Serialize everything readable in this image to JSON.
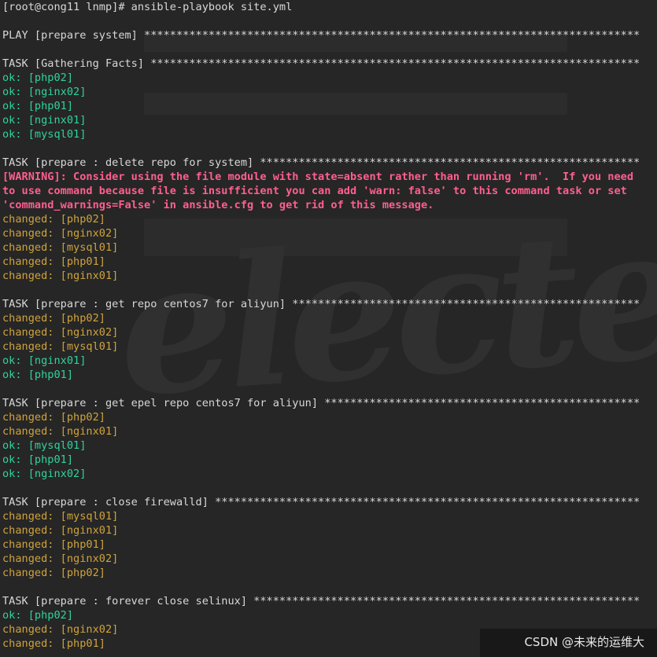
{
  "terminal": {
    "lines": [
      {
        "kind": "def",
        "text": "[root@cong11 lnmp]# ansible-playbook site.yml"
      },
      {
        "kind": "blank",
        "text": ""
      },
      {
        "kind": "def",
        "text": "PLAY [prepare system] *****************************************************************************"
      },
      {
        "kind": "blank",
        "text": ""
      },
      {
        "kind": "def",
        "text": "TASK [Gathering Facts] ****************************************************************************"
      },
      {
        "kind": "ok",
        "text": "ok: [php02]"
      },
      {
        "kind": "ok",
        "text": "ok: [nginx02]"
      },
      {
        "kind": "ok",
        "text": "ok: [php01]"
      },
      {
        "kind": "ok",
        "text": "ok: [nginx01]"
      },
      {
        "kind": "ok",
        "text": "ok: [mysql01]"
      },
      {
        "kind": "blank",
        "text": ""
      },
      {
        "kind": "def",
        "text": "TASK [prepare : delete repo for system] ***********************************************************"
      },
      {
        "kind": "warn",
        "text": "[WARNING]: Consider using the file module with state=absent rather than running 'rm'.  If you need"
      },
      {
        "kind": "warn",
        "text": "to use command because file is insufficient you can add 'warn: false' to this command task or set"
      },
      {
        "kind": "warn",
        "text": "'command_warnings=False' in ansible.cfg to get rid of this message."
      },
      {
        "kind": "changed",
        "text": "changed: [php02]"
      },
      {
        "kind": "changed",
        "text": "changed: [nginx02]"
      },
      {
        "kind": "changed",
        "text": "changed: [mysql01]"
      },
      {
        "kind": "changed",
        "text": "changed: [php01]"
      },
      {
        "kind": "changed",
        "text": "changed: [nginx01]"
      },
      {
        "kind": "blank",
        "text": ""
      },
      {
        "kind": "def",
        "text": "TASK [prepare : get repo centos7 for aliyun] ******************************************************"
      },
      {
        "kind": "changed",
        "text": "changed: [php02]"
      },
      {
        "kind": "changed",
        "text": "changed: [nginx02]"
      },
      {
        "kind": "changed",
        "text": "changed: [mysql01]"
      },
      {
        "kind": "ok",
        "text": "ok: [nginx01]"
      },
      {
        "kind": "ok",
        "text": "ok: [php01]"
      },
      {
        "kind": "blank",
        "text": ""
      },
      {
        "kind": "def",
        "text": "TASK [prepare : get epel repo centos7 for aliyun] *************************************************"
      },
      {
        "kind": "changed",
        "text": "changed: [php02]"
      },
      {
        "kind": "changed",
        "text": "changed: [nginx01]"
      },
      {
        "kind": "ok",
        "text": "ok: [mysql01]"
      },
      {
        "kind": "ok",
        "text": "ok: [php01]"
      },
      {
        "kind": "ok",
        "text": "ok: [nginx02]"
      },
      {
        "kind": "blank",
        "text": ""
      },
      {
        "kind": "def",
        "text": "TASK [prepare : close firewalld] ******************************************************************"
      },
      {
        "kind": "changed",
        "text": "changed: [mysql01]"
      },
      {
        "kind": "changed",
        "text": "changed: [nginx01]"
      },
      {
        "kind": "changed",
        "text": "changed: [php01]"
      },
      {
        "kind": "changed",
        "text": "changed: [nginx02]"
      },
      {
        "kind": "changed",
        "text": "changed: [php02]"
      },
      {
        "kind": "blank",
        "text": ""
      },
      {
        "kind": "def",
        "text": "TASK [prepare : forever close selinux] ************************************************************"
      },
      {
        "kind": "ok",
        "text": "ok: [php02]"
      },
      {
        "kind": "changed",
        "text": "changed: [nginx02]"
      },
      {
        "kind": "changed",
        "text": "changed: [php01]"
      }
    ]
  },
  "watermark": {
    "text": "electerm"
  },
  "footer": {
    "credit": "CSDN @未来的运维大"
  }
}
